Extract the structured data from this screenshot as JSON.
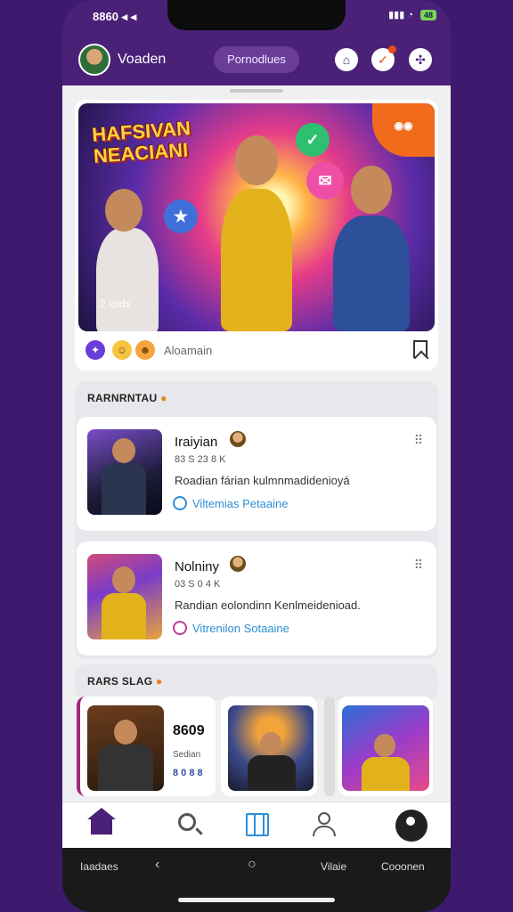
{
  "status": {
    "time": "8860 ◂ ◂",
    "signal": "▮▮▮ ◔",
    "battery": "48"
  },
  "header": {
    "title": "Voaden",
    "pill_label": "Pornodlues"
  },
  "hero": {
    "title_line1": "HAFSIVAN",
    "title_line2": "NEACIANI",
    "tag": "2 lolds",
    "author": "Aloamain",
    "reactions": [
      "✦",
      "☺",
      "☻"
    ]
  },
  "section1": {
    "heading": "RARNRNTAU"
  },
  "feed": [
    {
      "title": "Iraiyian",
      "meta": "83 S 23 8 K",
      "description": "Roadian fárian kulmnmadidenioyá",
      "link": "Viltemias Petaaine"
    },
    {
      "title": "Nolniny",
      "meta": "03 S 0 4 K",
      "description": "Randian eolondinn Kenlmeidenioad.",
      "link": "Vitrenilon Sotaaine"
    }
  ],
  "section2": {
    "heading": "RARS SLAG"
  },
  "carousel": {
    "first": {
      "number": "8609",
      "sub": "Sedian",
      "dots": "8 0 8 8"
    }
  },
  "tabs": [
    "home-icon",
    "search-icon",
    "newspaper-icon",
    "profile-icon",
    "record-icon"
  ],
  "system_nav": {
    "left_label": "Iaadaes",
    "back": "‹",
    "home": "○",
    "right1": "Vilaie",
    "right2": "Cooonen"
  },
  "colors": {
    "primary": "#4a2177",
    "accent": "#2d8fd6",
    "background": "#3d1a6e"
  }
}
